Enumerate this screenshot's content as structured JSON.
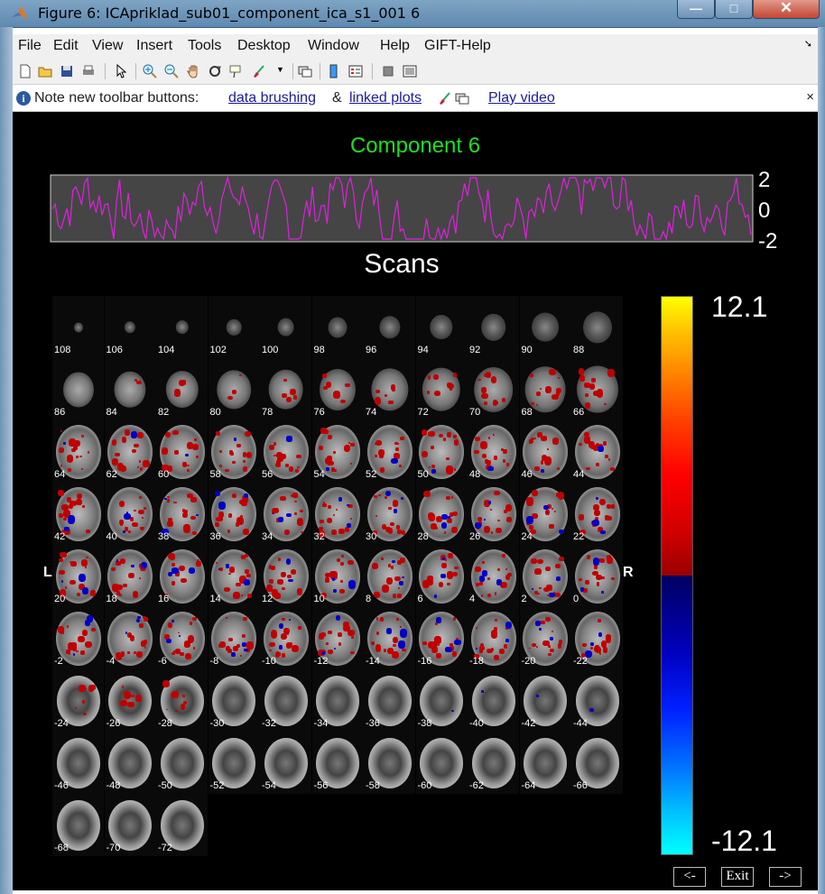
{
  "window": {
    "title": "Figure 6: ICApriklad_sub01_component_ica_s1_001 6",
    "close_glyph": "✕",
    "min_glyph": "—",
    "max_glyph": "□"
  },
  "menu": [
    "File",
    "Edit",
    "View",
    "Insert",
    "Tools",
    "Desktop",
    "Window",
    "Help",
    "GIFT-Help"
  ],
  "toolbar_icons": [
    "new-figure-icon",
    "open-icon",
    "save-icon",
    "print-icon",
    "pointer-icon",
    "zoom-in-icon",
    "zoom-out-icon",
    "pan-icon",
    "rotate-icon",
    "data-cursor-icon",
    "brush-icon",
    "link-icon",
    "colorbar-icon",
    "legend-icon",
    "hide-plot-tools-icon",
    "show-plot-tools-icon"
  ],
  "infobar": {
    "note": "Note new toolbar buttons:",
    "link1": "data brushing",
    "amp": "&",
    "link2": "linked plots",
    "link3": "Play video",
    "close": "×"
  },
  "figure": {
    "title": "Component 6",
    "xlabel": "Scans",
    "yticks": [
      "2",
      "0",
      "-2"
    ],
    "left_label": "L",
    "right_label": "R",
    "colorbar_max": "12.1",
    "colorbar_min": "-12.1",
    "colors": {
      "title": "#1ee01e",
      "timecourse": "#e020e0",
      "panel": "#454545",
      "positive": "#c00000",
      "negative": "#0000c8"
    }
  },
  "slices": [
    "108",
    "106",
    "104",
    "102",
    "100",
    "98",
    "96",
    "94",
    "92",
    "90",
    "88",
    "86",
    "84",
    "82",
    "80",
    "78",
    "76",
    "74",
    "72",
    "70",
    "68",
    "66",
    "64",
    "62",
    "60",
    "58",
    "56",
    "54",
    "52",
    "50",
    "48",
    "46",
    "44",
    "42",
    "40",
    "38",
    "36",
    "34",
    "32",
    "30",
    "28",
    "26",
    "24",
    "22",
    "20",
    "18",
    "16",
    "14",
    "12",
    "10",
    "8",
    "6",
    "4",
    "2",
    "0",
    "-2",
    "-4",
    "-6",
    "-8",
    "-10",
    "-12",
    "-14",
    "-16",
    "-18",
    "-20",
    "-22",
    "-24",
    "-26",
    "-28",
    "-30",
    "-32",
    "-34",
    "-36",
    "-38",
    "-40",
    "-42",
    "-44",
    "-46",
    "-48",
    "-50",
    "-52",
    "-54",
    "-56",
    "-58",
    "-60",
    "-62",
    "-64",
    "-66",
    "-68",
    "-70",
    "-72"
  ],
  "nav": {
    "prev": "<-",
    "exit": "Exit",
    "next": "->"
  }
}
